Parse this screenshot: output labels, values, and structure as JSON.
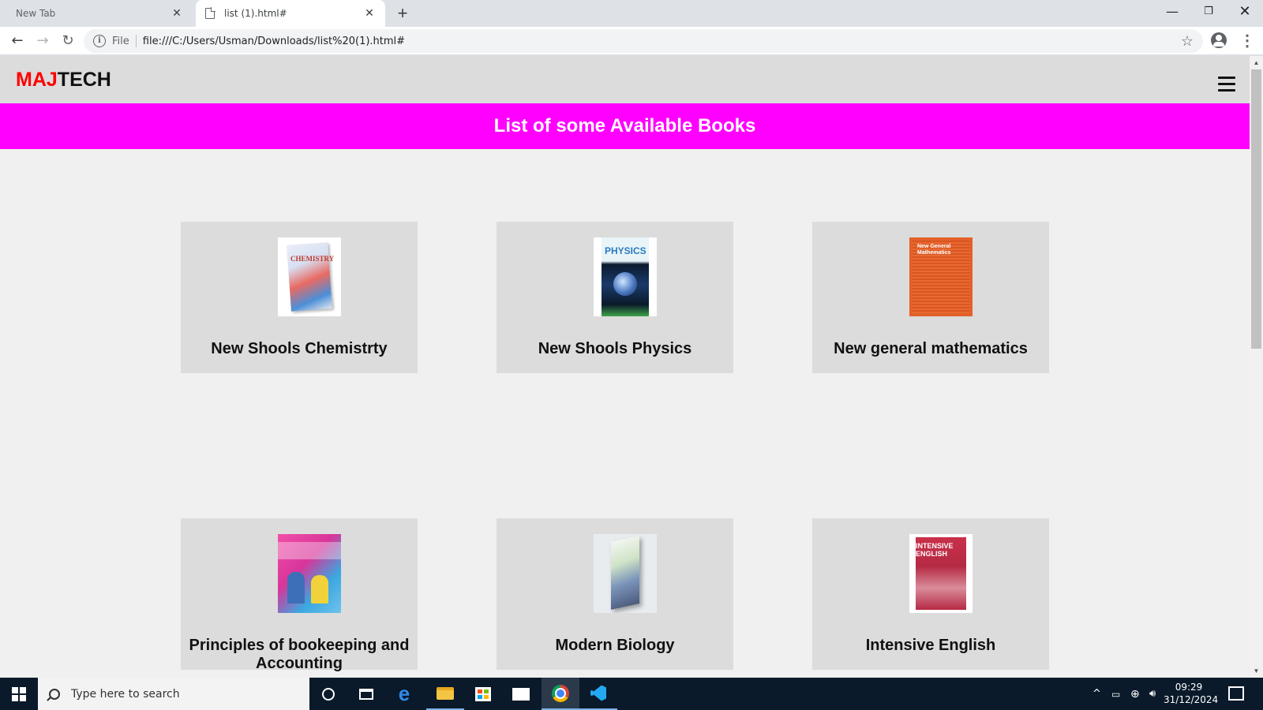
{
  "browser": {
    "tabs": [
      {
        "title": "New Tab",
        "active": false
      },
      {
        "title": "list (1).html#",
        "active": true
      }
    ],
    "new_tab_symbol": "+",
    "close_symbol": "✕",
    "window_controls": {
      "minimize": "—",
      "maximize": "❐",
      "close": "✕"
    },
    "nav": {
      "back": "←",
      "forward": "→",
      "reload": "↻"
    },
    "address": {
      "scheme_label": "File",
      "url": "file:///C:/Users/Usman/Downloads/list%20(1).html#"
    },
    "icons": [
      "info-icon",
      "star-icon",
      "account-icon",
      "more-menu-icon"
    ]
  },
  "site": {
    "logo": {
      "part1": "MAJ",
      "part2": "TECH",
      "part1_color": "#ff0000",
      "part2_color": "#111111"
    },
    "banner": {
      "text": "List of some Available Books",
      "color": "#ff00ff"
    },
    "books": [
      {
        "title": "New Shools Chemistrty",
        "cover_icon": "chemistry-book-cover"
      },
      {
        "title": "New Shools Physics",
        "cover_icon": "physics-book-cover"
      },
      {
        "title": "New general mathematics",
        "cover_icon": "mathematics-book-cover"
      },
      {
        "title": "Principles of bookeeping and Accounting",
        "cover_icon": "bookkeeping-book-cover"
      },
      {
        "title": "Modern Biology",
        "cover_icon": "biology-book-cover"
      },
      {
        "title": "Intensive English",
        "cover_icon": "english-book-cover"
      }
    ]
  },
  "taskbar": {
    "search_placeholder": "Type here to search",
    "apps": [
      "cortana-icon",
      "task-view-icon",
      "edge-icon",
      "file-explorer-icon",
      "store-icon",
      "mail-icon",
      "chrome-icon",
      "vscode-icon"
    ],
    "tray": {
      "chevron": "^",
      "time": "09:29",
      "date": "31/12/2024"
    }
  }
}
